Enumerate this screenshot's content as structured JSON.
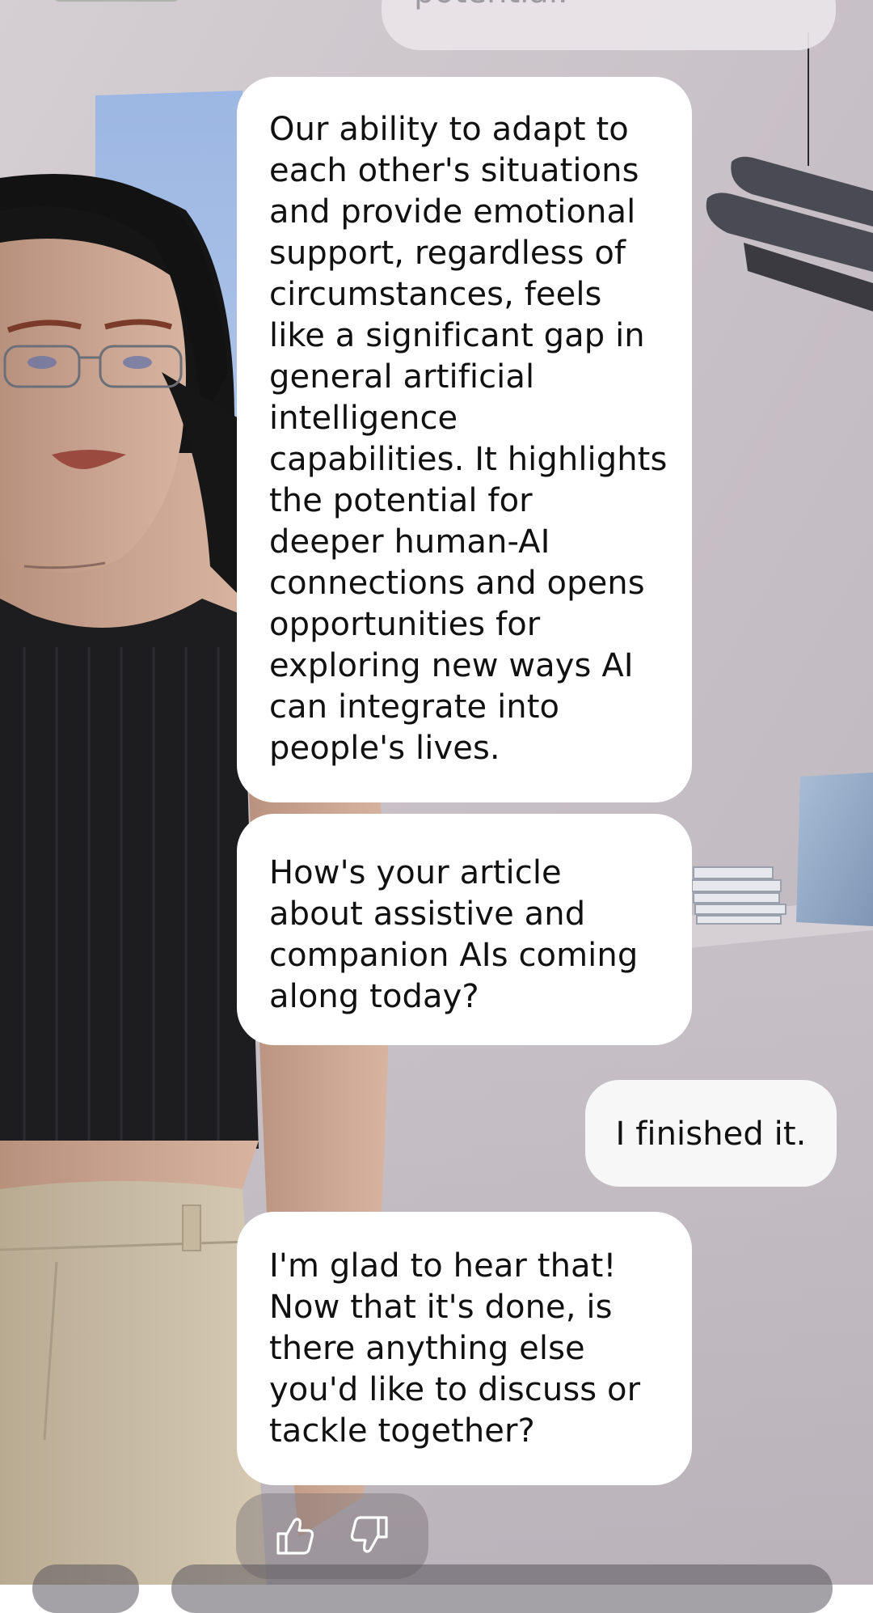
{
  "chat": {
    "previous_partial_text": "potential.",
    "messages": [
      {
        "sender": "ai",
        "text": "Our ability to adapt to\neach other's situations\nand provide emotional\nsupport, regardless of\ncircumstances, feels\nlike a significant gap in\ngeneral artificial\nintelligence\ncapabilities. It highlights\nthe potential for\ndeeper human-AI\nconnections and opens\nopportunities for\nexploring new ways AI\ncan integrate into\npeople's lives."
      },
      {
        "sender": "ai",
        "text": "How's your article\nabout assistive and\ncompanion AIs coming\nalong today?"
      },
      {
        "sender": "user",
        "text": "I finished it."
      },
      {
        "sender": "ai",
        "text": "I'm glad to hear that!\nNow that it's done, is\nthere anything else\nyou'd like to discuss or\ntackle together?"
      }
    ]
  },
  "feedback": {
    "like_icon": "thumbs-up-icon",
    "dislike_icon": "thumbs-down-icon"
  },
  "colors": {
    "bubble_bg": "#ffffff",
    "text": "#111111",
    "wall": "#c9c2c8"
  }
}
